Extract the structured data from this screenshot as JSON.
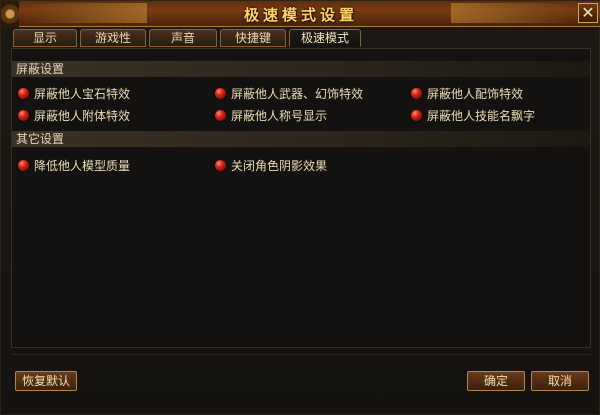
{
  "window": {
    "title": "极速模式设置",
    "close_symbol": "✕"
  },
  "tabs": [
    {
      "label": "显示",
      "active": false
    },
    {
      "label": "游戏性",
      "active": false
    },
    {
      "label": "声音",
      "active": false
    },
    {
      "label": "快捷键",
      "active": false
    },
    {
      "label": "极速模式",
      "active": true
    }
  ],
  "sections": [
    {
      "title": "屏蔽设置",
      "options": [
        "屏蔽他人宝石特效",
        "屏蔽他人武器、幻饰特效",
        "屏蔽他人配饰特效",
        "屏蔽他人附体特效",
        "屏蔽他人称号显示",
        "屏蔽他人技能名飘字"
      ]
    },
    {
      "title": "其它设置",
      "options": [
        "降低他人模型质量",
        "关闭角色阴影效果"
      ]
    }
  ],
  "buttons": {
    "restore_default": "恢复默认",
    "confirm": "确定",
    "cancel": "取消"
  },
  "icons": {
    "close": "close-icon",
    "option_marker": "red-radio-icon"
  },
  "colors": {
    "title_text": "#ffd36a",
    "radio_red": "#d8261a",
    "label_text": "#eadcb8"
  }
}
